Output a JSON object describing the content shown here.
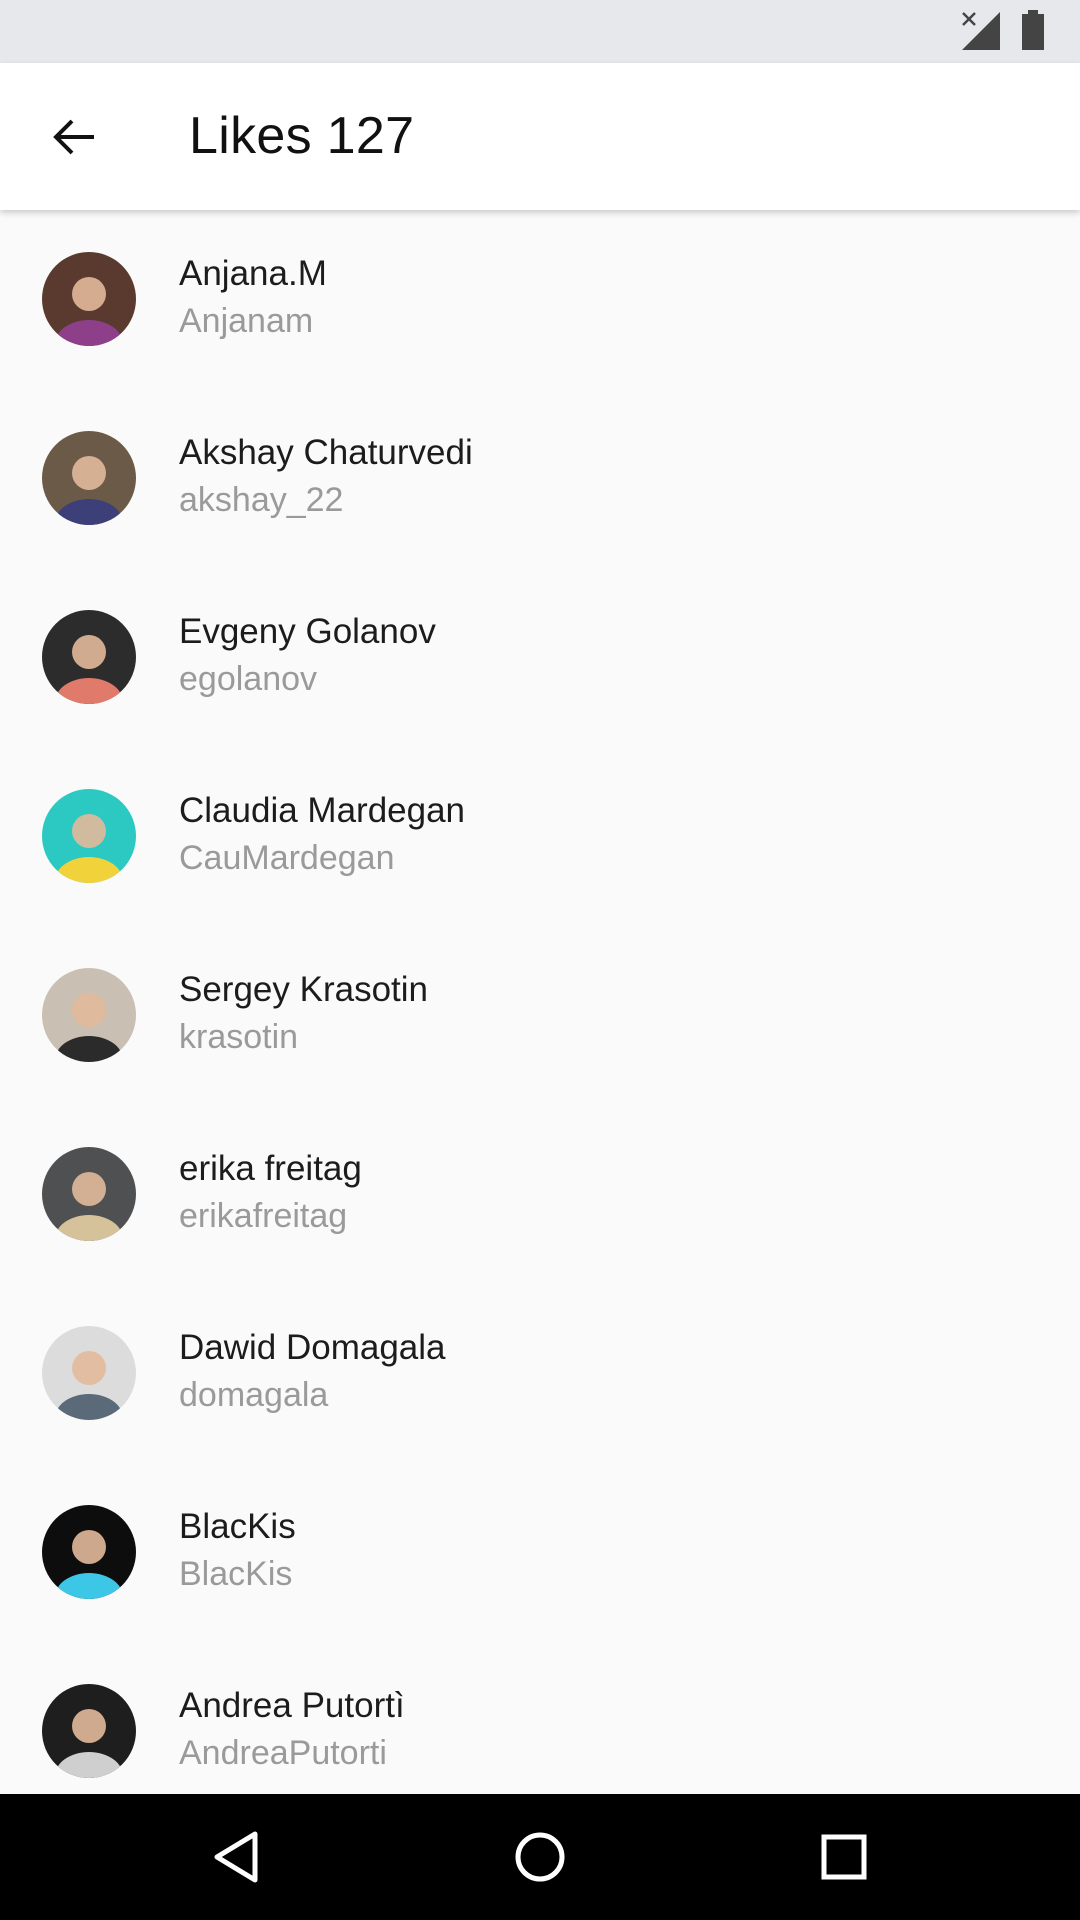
{
  "status_bar": {
    "icons": [
      "signal-no-service-icon",
      "battery-icon"
    ]
  },
  "header": {
    "back_icon": "arrow-back-icon",
    "title": "Likes 127"
  },
  "likes": [
    {
      "name": "Anjana.M",
      "username": "Anjanam",
      "avatar_color": "#5a3a2e",
      "avatar_accent": "#8e3f8a"
    },
    {
      "name": "Akshay Chaturvedi",
      "username": "akshay_22",
      "avatar_color": "#6b5a48",
      "avatar_accent": "#3c3f78"
    },
    {
      "name": "Evgeny Golanov",
      "username": "egolanov",
      "avatar_color": "#2c2c2c",
      "avatar_accent": "#e07a6a"
    },
    {
      "name": "Claudia Mardegan",
      "username": "CauMardegan",
      "avatar_color": "#2bc9c2",
      "avatar_accent": "#f2d23a"
    },
    {
      "name": "Sergey Krasotin",
      "username": "krasotin",
      "avatar_color": "#c9bfb2",
      "avatar_accent": "#2b2b2b"
    },
    {
      "name": "erika freitag",
      "username": "erikafreitag",
      "avatar_color": "#4e5051",
      "avatar_accent": "#d6c29a"
    },
    {
      "name": "Dawid Domagala",
      "username": "domagala",
      "avatar_color": "#dcdcdc",
      "avatar_accent": "#5a6a78"
    },
    {
      "name": "BlacKis",
      "username": "BlacKis",
      "avatar_color": "#0d0d0d",
      "avatar_accent": "#3cc7e6"
    },
    {
      "name": "Andrea Putortì",
      "username": "AndreaPutorti",
      "avatar_color": "#1e1e1e",
      "avatar_accent": "#cfcfcf"
    }
  ],
  "nav_bar": {
    "icons": [
      "nav-back-icon",
      "nav-home-icon",
      "nav-recents-icon"
    ]
  },
  "colors": {
    "background": "#fafafa",
    "status_bar": "#e6e8eb",
    "app_bar": "#ffffff",
    "name_text": "#1c1c1c",
    "username_text": "#9a9a9a",
    "nav_bar": "#000000"
  }
}
